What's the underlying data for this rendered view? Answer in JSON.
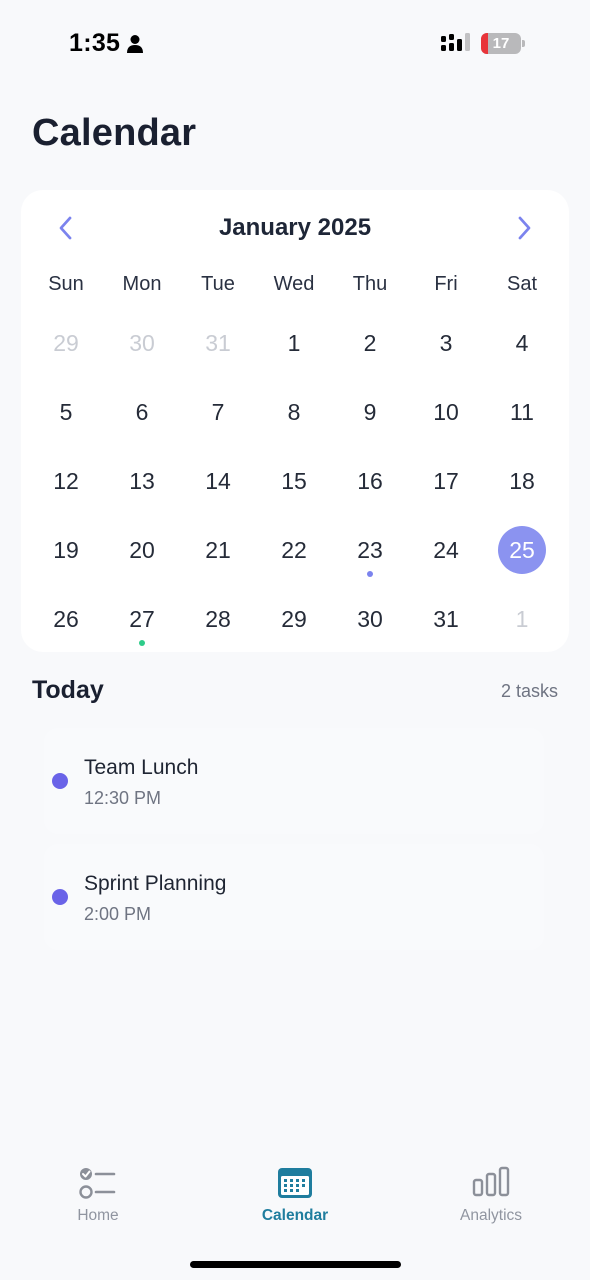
{
  "status_bar": {
    "time": "1:35",
    "battery": "17",
    "battery_level": 0.17,
    "battery_color": "#e8343a"
  },
  "page": {
    "title": "Calendar"
  },
  "calendar": {
    "month_label": "January 2025",
    "weekdays": [
      "Sun",
      "Mon",
      "Tue",
      "Wed",
      "Thu",
      "Fri",
      "Sat"
    ],
    "weeks": [
      [
        {
          "d": "29",
          "muted": true
        },
        {
          "d": "30",
          "muted": true
        },
        {
          "d": "31",
          "muted": true
        },
        {
          "d": "1"
        },
        {
          "d": "2"
        },
        {
          "d": "3"
        },
        {
          "d": "4"
        }
      ],
      [
        {
          "d": "5"
        },
        {
          "d": "6"
        },
        {
          "d": "7"
        },
        {
          "d": "8"
        },
        {
          "d": "9"
        },
        {
          "d": "10"
        },
        {
          "d": "11"
        }
      ],
      [
        {
          "d": "12"
        },
        {
          "d": "13"
        },
        {
          "d": "14"
        },
        {
          "d": "15"
        },
        {
          "d": "16"
        },
        {
          "d": "17"
        },
        {
          "d": "18"
        }
      ],
      [
        {
          "d": "19"
        },
        {
          "d": "20"
        },
        {
          "d": "21"
        },
        {
          "d": "22"
        },
        {
          "d": "23",
          "dot": "#7b83ee"
        },
        {
          "d": "24"
        },
        {
          "d": "25",
          "selected": true
        }
      ],
      [
        {
          "d": "26"
        },
        {
          "d": "27",
          "dot": "#2ecc8a"
        },
        {
          "d": "28"
        },
        {
          "d": "29"
        },
        {
          "d": "30"
        },
        {
          "d": "31"
        },
        {
          "d": "1",
          "muted": true
        }
      ]
    ],
    "selected_color": "#8b93f0"
  },
  "today": {
    "title": "Today",
    "count_label": "2 tasks",
    "tasks": [
      {
        "name": "Team Lunch",
        "time": "12:30 PM",
        "color": "#6a63e8"
      },
      {
        "name": "Sprint Planning",
        "time": "2:00 PM",
        "color": "#6a63e8"
      }
    ]
  },
  "tab_bar": {
    "home_label": "Home",
    "calendar_label": "Calendar",
    "analytics_label": "Analytics",
    "active": "Calendar",
    "active_color": "#1f7d9e"
  }
}
